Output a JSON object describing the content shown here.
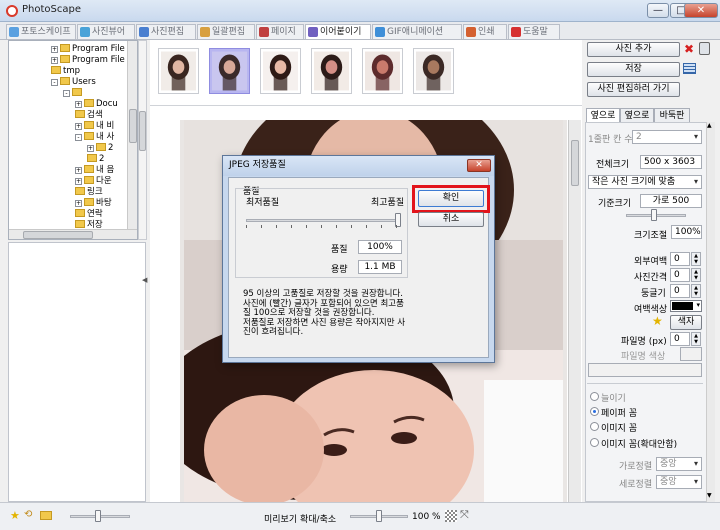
{
  "window": {
    "title": "PhotoScape",
    "min": "—",
    "max": "□",
    "close": "✕"
  },
  "tabs": [
    {
      "label": "포토스케이프",
      "color": "#5aa0e0"
    },
    {
      "label": "사진뷰어",
      "color": "#4aa3d8"
    },
    {
      "label": "사진편집",
      "color": "#4a7fd0"
    },
    {
      "label": "일괄편집",
      "color": "#d8a040"
    },
    {
      "label": "페이지",
      "color": "#c04040"
    },
    {
      "label": "이어붙이기",
      "color": "#7060c0"
    },
    {
      "label": "GIF애니메이션",
      "color": "#3f8fd8"
    },
    {
      "label": "인쇄",
      "color": "#d46030"
    },
    {
      "label": "도움말",
      "color": "#d63030"
    }
  ],
  "tree": [
    {
      "label": "Program File",
      "indent": 1,
      "box": "+"
    },
    {
      "label": "Program File",
      "indent": 1,
      "box": "+"
    },
    {
      "label": "tmp",
      "indent": 1,
      "box": ""
    },
    {
      "label": "Users",
      "indent": 1,
      "box": "-"
    },
    {
      "label": "",
      "indent": 2,
      "box": "-"
    },
    {
      "label": "Docu",
      "indent": 3,
      "box": "+"
    },
    {
      "label": "검색",
      "indent": 3,
      "box": ""
    },
    {
      "label": "내 비",
      "indent": 3,
      "box": "+"
    },
    {
      "label": "내 사",
      "indent": 3,
      "box": "-"
    },
    {
      "label": "2",
      "indent": 4,
      "box": "+"
    },
    {
      "label": "2",
      "indent": 4,
      "box": ""
    },
    {
      "label": "내 음",
      "indent": 3,
      "box": "+"
    },
    {
      "label": "다운",
      "indent": 3,
      "box": "+"
    },
    {
      "label": "링크",
      "indent": 3,
      "box": ""
    },
    {
      "label": "바탕",
      "indent": 3,
      "box": "+"
    },
    {
      "label": "연락",
      "indent": 3,
      "box": ""
    },
    {
      "label": "저장",
      "indent": 3,
      "box": ""
    }
  ],
  "thumbnails": [
    {
      "colors": [
        "#f1ece8",
        "#3a2620",
        "#e2b7a3"
      ],
      "selected": false
    },
    {
      "colors": [
        "#c9c6ef",
        "#3b2a2a",
        "#d9a898"
      ],
      "selected": true
    },
    {
      "colors": [
        "#f5f0ee",
        "#2e1a16",
        "#e8b9a6"
      ],
      "selected": false
    },
    {
      "colors": [
        "#f2ebe6",
        "#2c1b18",
        "#d58f86"
      ],
      "selected": false
    },
    {
      "colors": [
        "#efe7e3",
        "#5d2b2c",
        "#c97a6c"
      ],
      "selected": false
    },
    {
      "colors": [
        "#ece8e6",
        "#3b2925",
        "#a8795f"
      ],
      "selected": false
    }
  ],
  "right": {
    "add_photo": "사진 추가",
    "save": "저장",
    "goto_edit": "사진 편집하러 가기",
    "tabs": [
      "옆으로",
      "옆으로",
      "바둑판"
    ],
    "rows_label": "1줄판 칸 수",
    "rows_value": "2",
    "total_size_label": "전체크기",
    "total_size_value": "500 x 3603",
    "fit_mode": "작은 사진 크기에 맞춤",
    "base_size_label": "기준크기",
    "base_size_value": "가로 500",
    "zoom_label": "크기조절",
    "zoom_value": "100%",
    "outer_margin_label": "외부여백",
    "outer_margin_value": "0",
    "spacing_label": "사진간격",
    "spacing_value": "0",
    "rounding_label": "둥글기",
    "rounding_value": "0",
    "margin_color_label": "여백색상",
    "margin_color": "#000000",
    "color_btn": "색자",
    "line_label": "파일명 (px)",
    "line_value": "0",
    "line_color_label": "파일명 색상",
    "opt_none": "늘이기",
    "opt_paper": "페이퍼 꼼",
    "opt_image": "이미지 꼼",
    "opt_image_fit": "이미지 꼼(확대안함)",
    "halign_label": "가로정렬",
    "halign_value": "중앙",
    "valign_label": "세로정렬",
    "valign_value": "중앙"
  },
  "dialog": {
    "title": "JPEG 저장품질",
    "close": "✕",
    "group_title": "품질",
    "low": "최저품질",
    "high": "최고품질",
    "quality_level": 1.0,
    "quality_label": "품질",
    "quality_value": "100%",
    "size_label": "용량",
    "size_value": "1.1 MB",
    "info": "95 이상의 고품질로 저장할 것을 권장합니다.\n사진에 (빨간) 글자가 포함되어 있으면 최고품질 100으로 저장할 것을 권장합니다.\n저품질로 저장하면 사진 용량은 작아지지만 사진이 흐려집니다.",
    "ok": "확인",
    "cancel": "취소"
  },
  "bottom": {
    "preview_zoom_label": "미리보기 확대/축소",
    "preview_zoom_level": 0.5,
    "zoom_value": "100 %"
  }
}
